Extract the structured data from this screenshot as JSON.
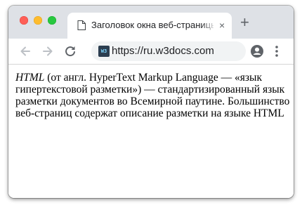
{
  "window": {
    "tab_title": "Заголовок окна веб-страницы",
    "tab_close": "×",
    "new_tab": "+"
  },
  "toolbar": {
    "url": "https://ru.w3docs.com",
    "site_icon_text": "W3"
  },
  "icons": {
    "back": "arrow-left-icon",
    "forward": "arrow-right-icon",
    "reload": "reload-icon",
    "account": "account-icon",
    "menu": "kebab-menu-icon",
    "page": "page-icon"
  },
  "page": {
    "abbr": "HTML",
    "text": " (от англ. HyperText Markup Language — «язык гипертекстовой разметки») — стандартизированный язык разметки документов во Всемирной паутине. Большинство веб-страниц содержат описание разметки на языке HTML"
  },
  "colors": {
    "titlebar": "#dee1e6",
    "close_light": "#fe5f57",
    "minimize_light": "#febc2e",
    "zoom_light": "#28c840"
  }
}
